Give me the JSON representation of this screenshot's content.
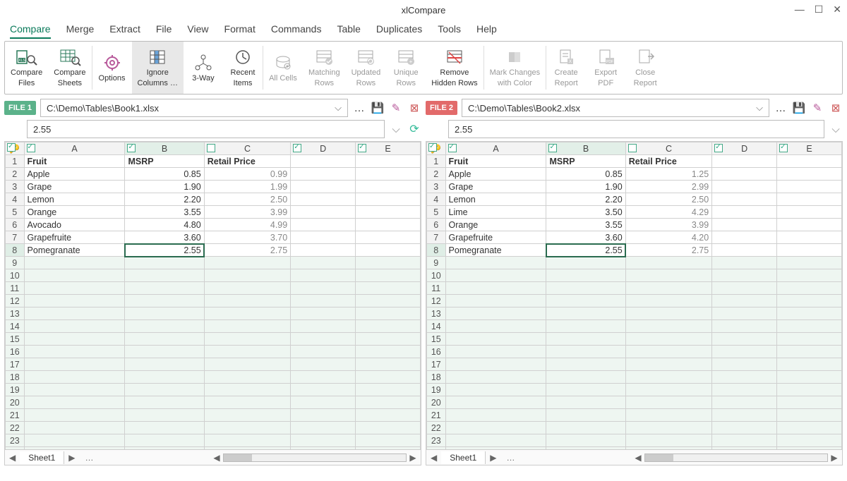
{
  "app": {
    "title": "xlCompare"
  },
  "menu": [
    "Compare",
    "Merge",
    "Extract",
    "File",
    "View",
    "Format",
    "Commands",
    "Table",
    "Duplicates",
    "Tools",
    "Help"
  ],
  "menu_active": 0,
  "ribbon": [
    {
      "id": "compare-files",
      "label": "Compare\nFiles"
    },
    {
      "id": "compare-sheets",
      "label": "Compare\nSheets"
    },
    {
      "sep": true
    },
    {
      "id": "options",
      "label": "Options"
    },
    {
      "id": "ignore-columns",
      "label": "Ignore\nColumns …",
      "sel": true
    },
    {
      "id": "three-way",
      "label": "3-Way"
    },
    {
      "id": "recent-items",
      "label": "Recent\nItems"
    },
    {
      "sep": true
    },
    {
      "id": "all-cells",
      "label": "All Cells",
      "disabled": true
    },
    {
      "id": "matching-rows",
      "label": "Matching\nRows",
      "disabled": true
    },
    {
      "id": "updated-rows",
      "label": "Updated\nRows",
      "disabled": true
    },
    {
      "id": "unique-rows",
      "label": "Unique\nRows",
      "disabled": true
    },
    {
      "id": "remove-hidden",
      "label": "Remove\nHidden Rows"
    },
    {
      "sep": true
    },
    {
      "id": "mark-changes",
      "label": "Mark Changes\nwith Color",
      "disabled": true
    },
    {
      "sep": true
    },
    {
      "id": "create-report",
      "label": "Create\nReport",
      "disabled": true
    },
    {
      "id": "export-pdf",
      "label": "Export\nPDF",
      "disabled": true
    },
    {
      "id": "close-report",
      "label": "Close\nReport",
      "disabled": true
    }
  ],
  "files": {
    "left": {
      "tag": "FILE 1",
      "path": "C:\\Demo\\Tables\\Book1.xlsx"
    },
    "right": {
      "tag": "FILE 2",
      "path": "C:\\Demo\\Tables\\Book2.xlsx"
    }
  },
  "formula": {
    "left": "2.55",
    "right": "2.55"
  },
  "columns": [
    "A",
    "B",
    "C",
    "D",
    "E"
  ],
  "col_checks": [
    true,
    true,
    false,
    true,
    true
  ],
  "left_grid": {
    "headers": [
      "Fruit",
      "MSRP",
      "Retail Price",
      "",
      ""
    ],
    "rows": [
      [
        "Apple",
        "0.85",
        "0.99",
        "",
        ""
      ],
      [
        "Grape",
        "1.90",
        "1.99",
        "",
        ""
      ],
      [
        "Lemon",
        "2.20",
        "2.50",
        "",
        ""
      ],
      [
        "Orange",
        "3.55",
        "3.99",
        "",
        ""
      ],
      [
        "Avocado",
        "4.80",
        "4.99",
        "",
        ""
      ],
      [
        "Grapefruite",
        "3.60",
        "3.70",
        "",
        ""
      ],
      [
        "Pomegranate",
        "2.55",
        "2.75",
        "",
        ""
      ]
    ],
    "sel_row": 7,
    "sel_col": 1
  },
  "right_grid": {
    "headers": [
      "Fruit",
      "MSRP",
      "Retail Price",
      "",
      ""
    ],
    "rows": [
      [
        "Apple",
        "0.85",
        "1.25",
        "",
        ""
      ],
      [
        "Grape",
        "1.90",
        "2.99",
        "",
        ""
      ],
      [
        "Lemon",
        "2.20",
        "2.50",
        "",
        ""
      ],
      [
        "Lime",
        "3.50",
        "4.29",
        "",
        ""
      ],
      [
        "Orange",
        "3.55",
        "3.99",
        "",
        ""
      ],
      [
        "Grapefruite",
        "3.60",
        "4.20",
        "",
        ""
      ],
      [
        "Pomegranate",
        "2.55",
        "2.75",
        "",
        ""
      ]
    ],
    "sel_row": 7,
    "sel_col": 1
  },
  "blank_rows": 24,
  "sheet_tab": "Sheet1"
}
